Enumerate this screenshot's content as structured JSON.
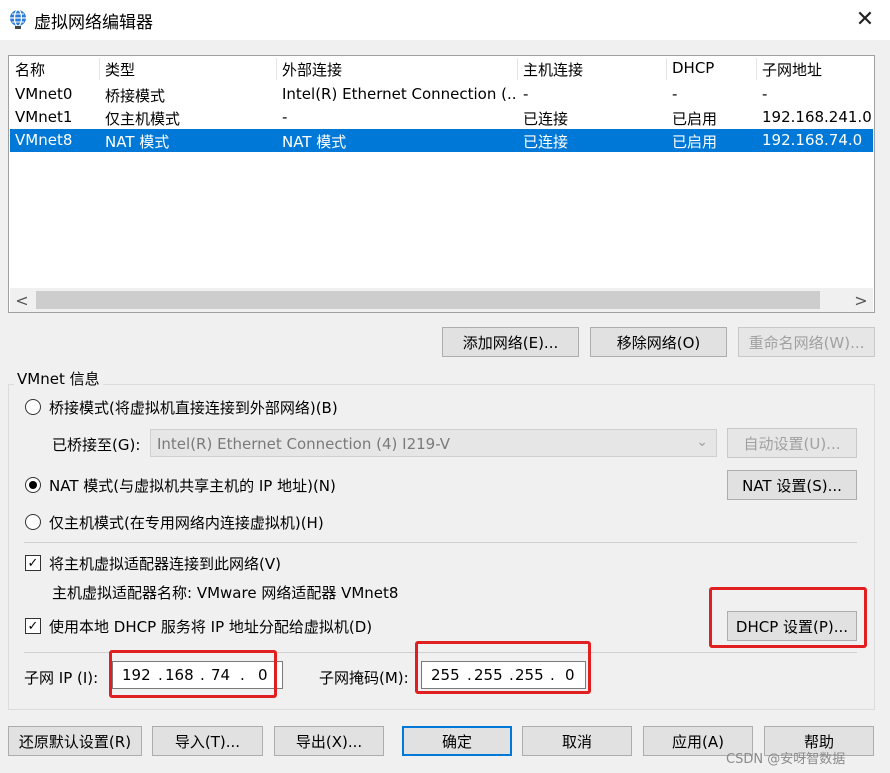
{
  "window": {
    "title": "虚拟网络编辑器",
    "close_glyph": "✕"
  },
  "list": {
    "columns": [
      "名称",
      "类型",
      "外部连接",
      "主机连接",
      "DHCP",
      "子网地址"
    ],
    "rows": [
      [
        "VMnet0",
        "桥接模式",
        "Intel(R) Ethernet Connection (...",
        "-",
        "-",
        "-"
      ],
      [
        "VMnet1",
        "仅主机模式",
        "-",
        "已连接",
        "已启用",
        "192.168.241.0"
      ],
      [
        "VMnet8",
        "NAT 模式",
        "NAT 模式",
        "已连接",
        "已启用",
        "192.168.74.0"
      ]
    ],
    "selected_row": 2,
    "scroll_left": "<",
    "scroll_right": ">"
  },
  "network_buttons": {
    "add": "添加网络(E)...",
    "remove": "移除网络(O)",
    "rename": "重命名网络(W)..."
  },
  "vmnet_info": {
    "title": "VMnet 信息",
    "bridged_label": "桥接模式(将虚拟机直接连接到外部网络)(B)",
    "bridged_to_label": "已桥接至(G):",
    "bridged_to_value": "Intel(R) Ethernet Connection (4) I219-V",
    "auto_settings": "自动设置(U)...",
    "nat_label": "NAT 模式(与虚拟机共享主机的 IP 地址)(N)",
    "nat_settings": "NAT 设置(S)...",
    "hostonly_label": "仅主机模式(在专用网络内连接虚拟机)(H)",
    "connect_adapter_label": "将主机虚拟适配器连接到此网络(V)",
    "adapter_name_label": "主机虚拟适配器名称: VMware 网络适配器 VMnet8",
    "dhcp_label": "使用本地 DHCP 服务将 IP 地址分配给虚拟机(D)",
    "dhcp_settings": "DHCP 设置(P)...",
    "check_glyph": "✓",
    "subnet_ip_label": "子网 IP (I):",
    "subnet_ip": [
      "192",
      "168",
      "74",
      "0"
    ],
    "subnet_mask_label": "子网掩码(M):",
    "subnet_mask": [
      "255",
      "255",
      "255",
      "0"
    ],
    "mode_selected": "nat",
    "connect_adapter_checked": true,
    "dhcp_checked": true
  },
  "footer_buttons": {
    "restore": "还原默认设置(R)",
    "import": "导入(T)...",
    "export": "导出(X)...",
    "ok": "确定",
    "cancel": "取消",
    "apply": "应用(A)",
    "help": "帮助"
  },
  "watermark": "CSDN @安呀智数据"
}
